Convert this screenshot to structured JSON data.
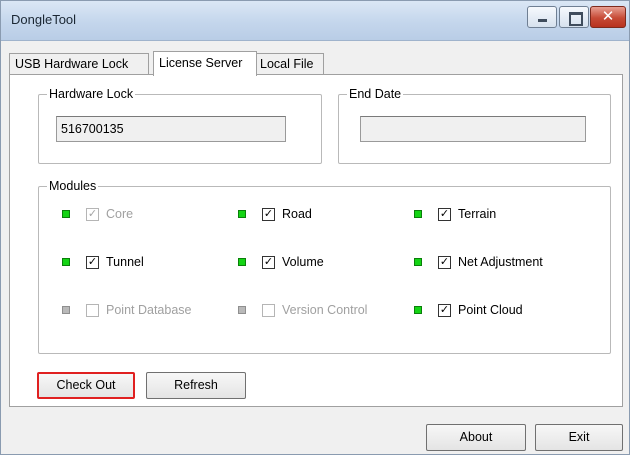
{
  "window": {
    "title": "DongleTool",
    "close_glyph": "✕"
  },
  "tabs": [
    {
      "label": "USB Hardware Lock",
      "active": false
    },
    {
      "label": "License Server",
      "active": true
    },
    {
      "label": "Local File",
      "active": false
    }
  ],
  "hardware_lock": {
    "legend": "Hardware Lock",
    "value": "516700135"
  },
  "end_date": {
    "legend": "End Date",
    "value": ""
  },
  "modules": {
    "legend": "Modules",
    "items": [
      {
        "label": "Core",
        "led": "on",
        "checked": true,
        "enabled": false
      },
      {
        "label": "Road",
        "led": "on",
        "checked": true,
        "enabled": true
      },
      {
        "label": "Terrain",
        "led": "on",
        "checked": true,
        "enabled": true
      },
      {
        "label": "Tunnel",
        "led": "on",
        "checked": true,
        "enabled": true
      },
      {
        "label": "Volume",
        "led": "on",
        "checked": true,
        "enabled": true
      },
      {
        "label": "Net Adjustment",
        "led": "on",
        "checked": true,
        "enabled": true
      },
      {
        "label": "Point Database",
        "led": "off",
        "checked": false,
        "enabled": false
      },
      {
        "label": "Version Control",
        "led": "off",
        "checked": false,
        "enabled": false
      },
      {
        "label": "Point Cloud",
        "led": "on",
        "checked": true,
        "enabled": true
      }
    ]
  },
  "check_glyph": "✓",
  "buttons": {
    "check_out": "Check Out",
    "refresh": "Refresh",
    "about": "About",
    "exit": "Exit"
  },
  "colors": {
    "led_on": "#14d414",
    "led_off": "#b9b9b9",
    "focus_border": "#e02020",
    "close_button": "#c64a36"
  }
}
